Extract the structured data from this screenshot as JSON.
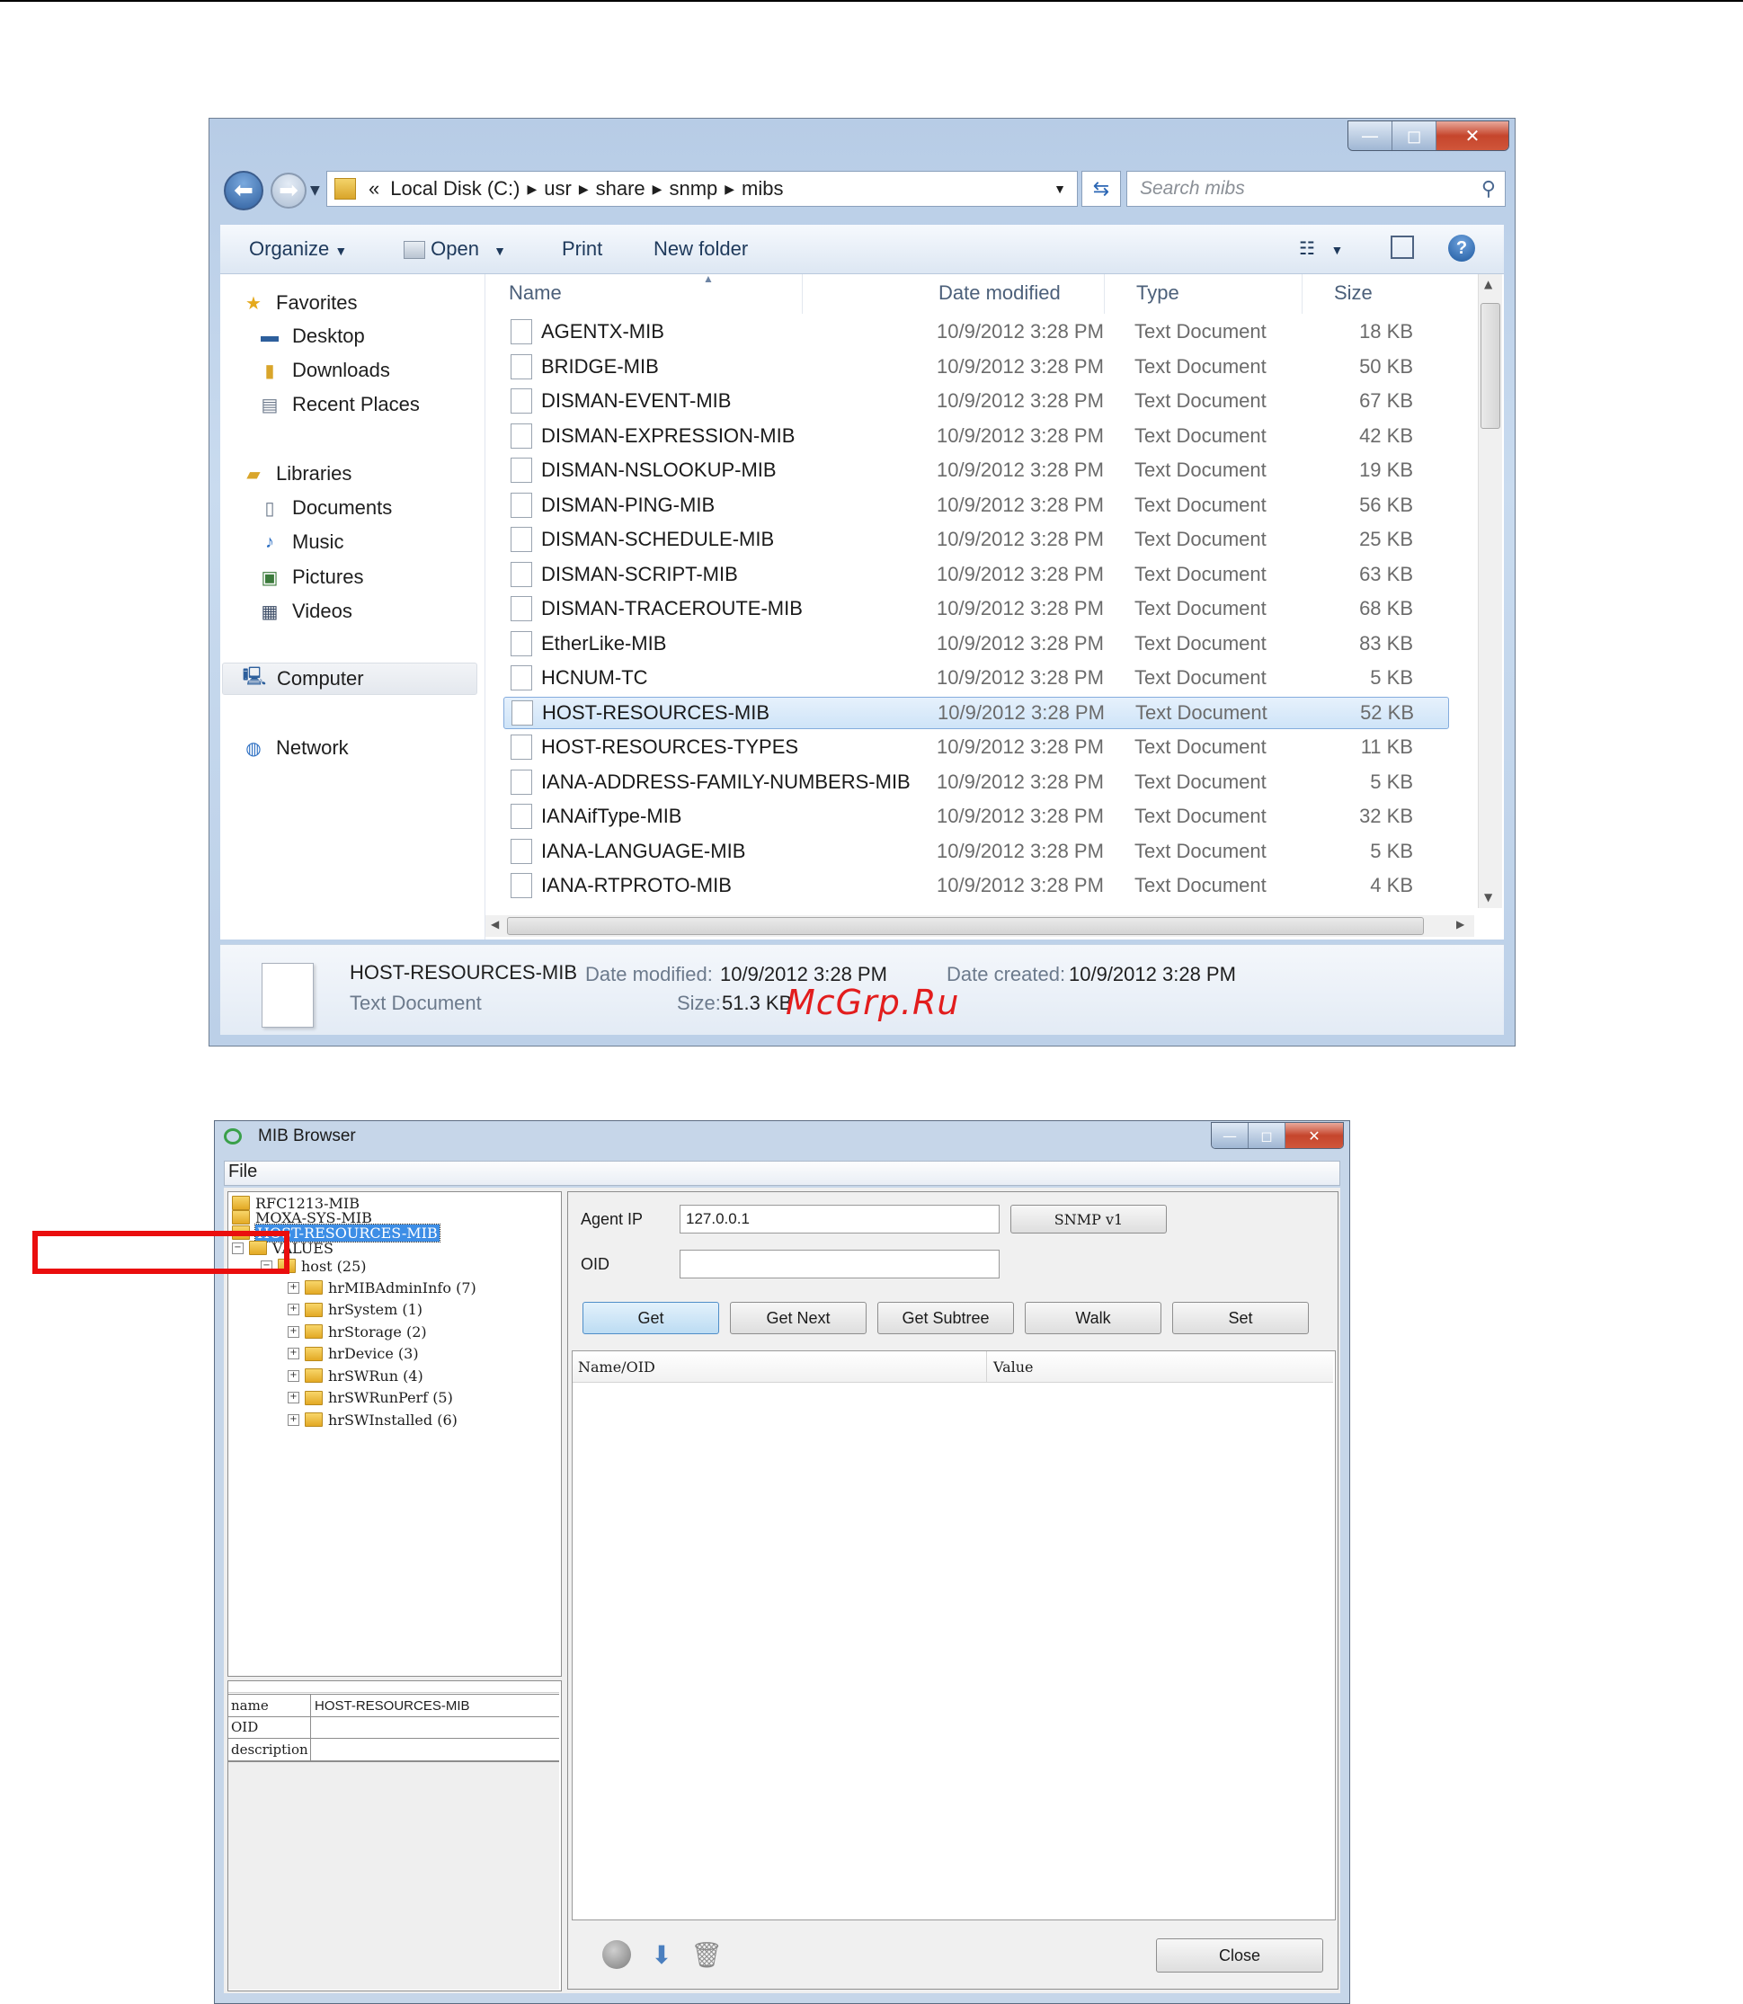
{
  "explorer": {
    "caption_buttons": {
      "minimize": "—",
      "maximize": "◻",
      "close": "✕"
    },
    "address": {
      "prefix": "«",
      "crumbs": [
        "Local Disk (C:)",
        "usr",
        "share",
        "snmp",
        "mibs"
      ]
    },
    "search_placeholder": "Search mibs",
    "toolbar": {
      "organize": "Organize",
      "open": "Open",
      "print": "Print",
      "new_folder": "New folder"
    },
    "nav": {
      "favorites": "Favorites",
      "desktop": "Desktop",
      "downloads": "Downloads",
      "recent_places": "Recent Places",
      "libraries": "Libraries",
      "documents": "Documents",
      "music": "Music",
      "pictures": "Pictures",
      "videos": "Videos",
      "computer": "Computer",
      "network": "Network"
    },
    "columns": {
      "name": "Name",
      "date": "Date modified",
      "type": "Type",
      "size": "Size"
    },
    "files": [
      {
        "name": "AGENTX-MIB",
        "date": "10/9/2012 3:28 PM",
        "type": "Text Document",
        "size": "18 KB"
      },
      {
        "name": "BRIDGE-MIB",
        "date": "10/9/2012 3:28 PM",
        "type": "Text Document",
        "size": "50 KB"
      },
      {
        "name": "DISMAN-EVENT-MIB",
        "date": "10/9/2012 3:28 PM",
        "type": "Text Document",
        "size": "67 KB"
      },
      {
        "name": "DISMAN-EXPRESSION-MIB",
        "date": "10/9/2012 3:28 PM",
        "type": "Text Document",
        "size": "42 KB"
      },
      {
        "name": "DISMAN-NSLOOKUP-MIB",
        "date": "10/9/2012 3:28 PM",
        "type": "Text Document",
        "size": "19 KB"
      },
      {
        "name": "DISMAN-PING-MIB",
        "date": "10/9/2012 3:28 PM",
        "type": "Text Document",
        "size": "56 KB"
      },
      {
        "name": "DISMAN-SCHEDULE-MIB",
        "date": "10/9/2012 3:28 PM",
        "type": "Text Document",
        "size": "25 KB"
      },
      {
        "name": "DISMAN-SCRIPT-MIB",
        "date": "10/9/2012 3:28 PM",
        "type": "Text Document",
        "size": "63 KB"
      },
      {
        "name": "DISMAN-TRACEROUTE-MIB",
        "date": "10/9/2012 3:28 PM",
        "type": "Text Document",
        "size": "68 KB"
      },
      {
        "name": "EtherLike-MIB",
        "date": "10/9/2012 3:28 PM",
        "type": "Text Document",
        "size": "83 KB"
      },
      {
        "name": "HCNUM-TC",
        "date": "10/9/2012 3:28 PM",
        "type": "Text Document",
        "size": "5 KB"
      },
      {
        "name": "HOST-RESOURCES-MIB",
        "date": "10/9/2012 3:28 PM",
        "type": "Text Document",
        "size": "52 KB",
        "selected": true
      },
      {
        "name": "HOST-RESOURCES-TYPES",
        "date": "10/9/2012 3:28 PM",
        "type": "Text Document",
        "size": "11 KB"
      },
      {
        "name": "IANA-ADDRESS-FAMILY-NUMBERS-MIB",
        "date": "10/9/2012 3:28 PM",
        "type": "Text Document",
        "size": "5 KB"
      },
      {
        "name": "IANAifType-MIB",
        "date": "10/9/2012 3:28 PM",
        "type": "Text Document",
        "size": "32 KB"
      },
      {
        "name": "IANA-LANGUAGE-MIB",
        "date": "10/9/2012 3:28 PM",
        "type": "Text Document",
        "size": "5 KB"
      },
      {
        "name": "IANA-RTPROTO-MIB",
        "date": "10/9/2012 3:28 PM",
        "type": "Text Document",
        "size": "4 KB"
      }
    ],
    "details": {
      "name": "HOST-RESOURCES-MIB",
      "type": "Text Document",
      "date_modified_label": "Date modified:",
      "date_modified": "10/9/2012 3:28 PM",
      "date_created_label": "Date created:",
      "date_created": "10/9/2012 3:28 PM",
      "size_label": "Size:",
      "size": "51.3 KB"
    }
  },
  "watermark": "McGrp.Ru",
  "mib_browser": {
    "title": "MIB Browser",
    "menu_file": "File",
    "tree": {
      "root1": "RFC1213-MIB",
      "root2": "MOXA-SYS-MIB",
      "root3": "HOST-RESOURCES-MIB",
      "values": "VALUES",
      "host": "host (25)",
      "children": [
        "hrMIBAdminInfo (7)",
        "hrSystem (1)",
        "hrStorage (2)",
        "hrDevice (3)",
        "hrSWRun (4)",
        "hrSWRunPerf (5)",
        "hrSWInstalled (6)"
      ]
    },
    "props": {
      "name_label": "name",
      "name_value": "HOST-RESOURCES-MIB",
      "oid_label": "OID",
      "oid_value": "",
      "description_label": "description",
      "description_value": ""
    },
    "agent_ip_label": "Agent IP",
    "agent_ip": "127.0.0.1",
    "snmp_version": "SNMP v1",
    "oid_label": "OID",
    "oid_value": "",
    "buttons": {
      "get": "Get",
      "get_next": "Get Next",
      "get_subtree": "Get Subtree",
      "walk": "Walk",
      "set": "Set",
      "close": "Close"
    },
    "columns": {
      "name_oid": "Name/OID",
      "value": "Value"
    }
  },
  "colors": {
    "highlight_box": "#ea0e0e",
    "selection": "#3d8ee6",
    "watermark": "#e21d1d"
  }
}
